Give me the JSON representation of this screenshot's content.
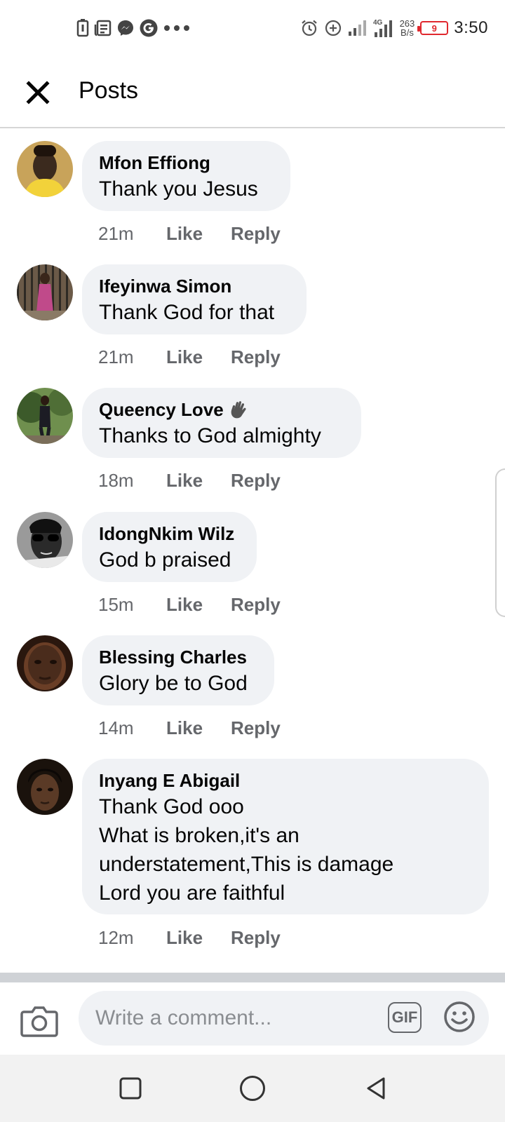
{
  "status_bar": {
    "time": "3:50",
    "net_speed_value": "263",
    "net_speed_unit": "B/s",
    "network_type": "4G",
    "battery_level": "9",
    "battery_color": "#e0282e",
    "left_icons": [
      "battery-saver-icon",
      "news-icon",
      "messenger-icon",
      "google-icon",
      "more-icon"
    ],
    "right_icons": [
      "alarm-icon",
      "data-saver-icon",
      "signal-icon",
      "signal-4g-icon"
    ]
  },
  "header": {
    "title": "Posts",
    "close_icon": "close-icon"
  },
  "comments": [
    {
      "author": "Mfon Effiong",
      "lines": [
        "Thank you Jesus"
      ],
      "time": "21m",
      "like_label": "Like",
      "reply_label": "Reply",
      "avatar_colors": [
        "#c8a35a",
        "#3b2a1e",
        "#f2d23a"
      ]
    },
    {
      "author": "Ifeyinwa Simon",
      "lines": [
        "Thank God for that"
      ],
      "time": "21m",
      "like_label": "Like",
      "reply_label": "Reply",
      "avatar_colors": [
        "#6b5a48",
        "#2e2a24",
        "#c04a8a"
      ]
    },
    {
      "author": "Queency Love",
      "author_badge": "waving-hand-icon",
      "lines": [
        "Thanks to God almighty"
      ],
      "time": "18m",
      "like_label": "Like",
      "reply_label": "Reply",
      "avatar_colors": [
        "#6f8f4e",
        "#3c5a2a",
        "#1c1c24"
      ]
    },
    {
      "author": "IdongNkim Wilz",
      "lines": [
        "God b praised"
      ],
      "time": "15m",
      "like_label": "Like",
      "reply_label": "Reply",
      "avatar_colors": [
        "#9a9a9a",
        "#2a2a2a",
        "#e9e9e9"
      ]
    },
    {
      "author": "Blessing Charles",
      "lines": [
        "Glory be to God"
      ],
      "time": "14m",
      "like_label": "Like",
      "reply_label": "Reply",
      "avatar_colors": [
        "#4a2c1c",
        "#6a3e26",
        "#2a170e"
      ]
    },
    {
      "author": "Inyang E Abigail",
      "lines": [
        "Thank God ooo",
        "What is broken,it's an",
        "understatement,This is damage",
        "Lord you are faithful"
      ],
      "time": "12m",
      "like_label": "Like",
      "reply_label": "Reply",
      "avatar_colors": [
        "#1a120c",
        "#5a3a26",
        "#2b1b12"
      ]
    }
  ],
  "composer": {
    "placeholder": "Write a comment...",
    "gif_label": "GIF",
    "camera_icon": "camera-icon",
    "emoji_icon": "emoji-icon"
  },
  "nav_bar": {
    "buttons": [
      "recents-square-icon",
      "home-circle-icon",
      "back-triangle-icon"
    ]
  }
}
